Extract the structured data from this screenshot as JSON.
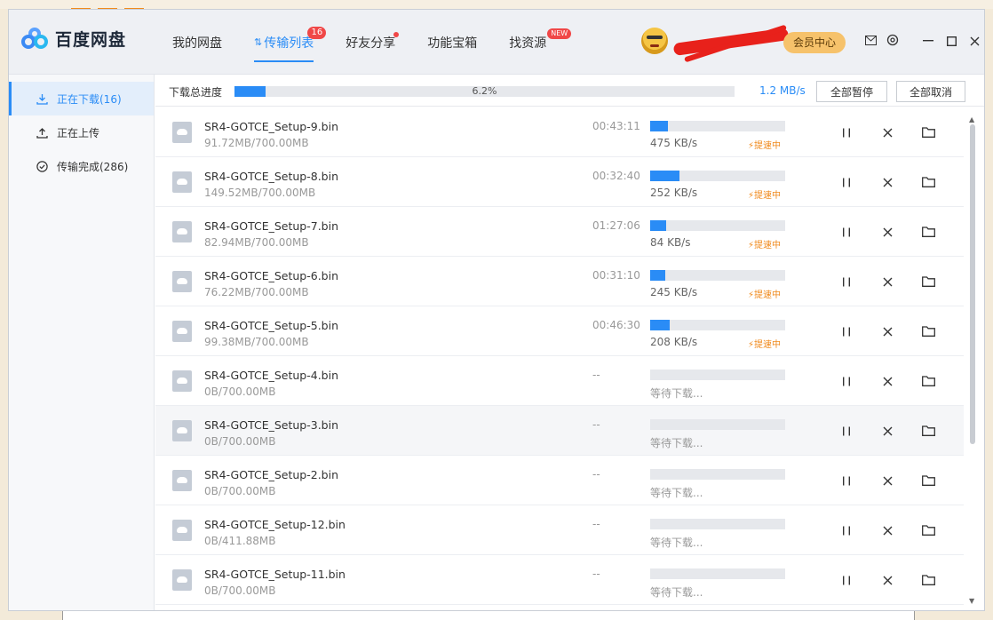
{
  "app": {
    "name": "百度网盘"
  },
  "nav": {
    "tabs": [
      {
        "label": "我的网盘"
      },
      {
        "label": "传输列表",
        "badge": "16"
      },
      {
        "label": "好友分享"
      },
      {
        "label": "功能宝箱"
      },
      {
        "label": "找资源",
        "badge": "NEW"
      }
    ],
    "vip_label": "会员中心"
  },
  "sidebar": {
    "items": [
      {
        "label": "正在下载(16)",
        "icon": "download-icon"
      },
      {
        "label": "正在上传",
        "icon": "upload-icon"
      },
      {
        "label": "传输完成(286)",
        "icon": "check-circle-icon"
      }
    ]
  },
  "toolbar": {
    "progress_label": "下载总进度",
    "progress_percent": "6.2%",
    "progress_fraction": 0.062,
    "speed": "1.2 MB/s",
    "pause_all_label": "全部暂停",
    "cancel_all_label": "全部取消"
  },
  "downloads": [
    {
      "name": "SR4-GOTCE_Setup-9.bin",
      "size": "91.72MB/700.00MB",
      "time": "00:43:11",
      "progress": 0.131,
      "speed": "475 KB/s",
      "boost": "提速中"
    },
    {
      "name": "SR4-GOTCE_Setup-8.bin",
      "size": "149.52MB/700.00MB",
      "time": "00:32:40",
      "progress": 0.214,
      "speed": "252 KB/s",
      "boost": "提速中"
    },
    {
      "name": "SR4-GOTCE_Setup-7.bin",
      "size": "82.94MB/700.00MB",
      "time": "01:27:06",
      "progress": 0.118,
      "speed": "84 KB/s",
      "boost": "提速中"
    },
    {
      "name": "SR4-GOTCE_Setup-6.bin",
      "size": "76.22MB/700.00MB",
      "time": "00:31:10",
      "progress": 0.109,
      "speed": "245 KB/s",
      "boost": "提速中"
    },
    {
      "name": "SR4-GOTCE_Setup-5.bin",
      "size": "99.38MB/700.00MB",
      "time": "00:46:30",
      "progress": 0.142,
      "speed": "208 KB/s",
      "boost": "提速中"
    },
    {
      "name": "SR4-GOTCE_Setup-4.bin",
      "size": "0B/700.00MB",
      "time": "--",
      "progress": 0,
      "wait": "等待下载..."
    },
    {
      "name": "SR4-GOTCE_Setup-3.bin",
      "size": "0B/700.00MB",
      "time": "--",
      "progress": 0,
      "wait": "等待下载..."
    },
    {
      "name": "SR4-GOTCE_Setup-2.bin",
      "size": "0B/700.00MB",
      "time": "--",
      "progress": 0,
      "wait": "等待下载..."
    },
    {
      "name": "SR4-GOTCE_Setup-12.bin",
      "size": "0B/411.88MB",
      "time": "--",
      "progress": 0,
      "wait": "等待下载..."
    },
    {
      "name": "SR4-GOTCE_Setup-11.bin",
      "size": "0B/700.00MB",
      "time": "--",
      "progress": 0,
      "wait": "等待下载..."
    }
  ],
  "colors": {
    "accent": "#2a8cf6",
    "boost": "#f08a1c",
    "badge": "#f04747",
    "vip": "#f6c26b"
  }
}
